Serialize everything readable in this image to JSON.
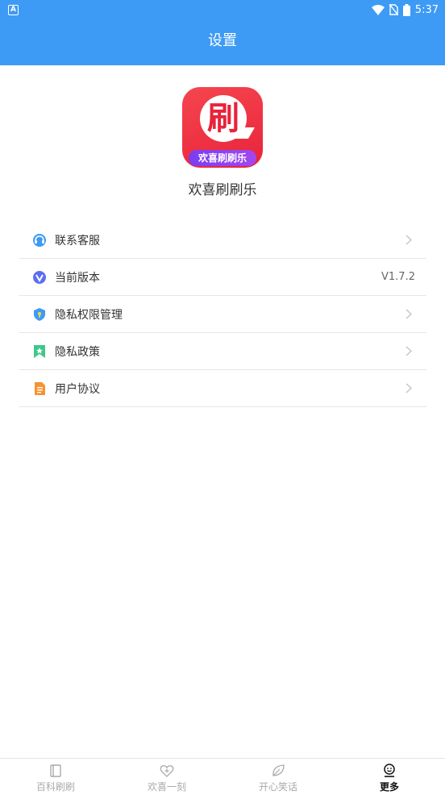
{
  "status_bar": {
    "time": "5:37",
    "app_indicator": "A"
  },
  "header": {
    "title": "设置"
  },
  "app": {
    "logo_char": "刷",
    "logo_banner": "欢喜刷刷乐",
    "name": "欢喜刷刷乐"
  },
  "menu": {
    "items": [
      {
        "label": "联系客服",
        "icon": "headset-icon",
        "color": "#3d9bf5"
      },
      {
        "label": "当前版本",
        "icon": "version-icon",
        "color": "#5b6ff0",
        "value": "V1.7.2"
      },
      {
        "label": "隐私权限管理",
        "icon": "shield-icon",
        "color": "#3d9bf5"
      },
      {
        "label": "隐私政策",
        "icon": "bookmark-icon",
        "color": "#3fc78a"
      },
      {
        "label": "用户协议",
        "icon": "document-icon",
        "color": "#f5932f"
      }
    ]
  },
  "tabbar": {
    "tabs": [
      {
        "label": "百科刷刷",
        "icon": "book-icon"
      },
      {
        "label": "欢喜一刻",
        "icon": "heart-plus-icon"
      },
      {
        "label": "开心笑话",
        "icon": "leaf-icon"
      },
      {
        "label": "更多",
        "icon": "smiley-icon",
        "active": true
      }
    ]
  },
  "colors": {
    "accent": "#3d9bf5",
    "divider": "#e6e6e6"
  }
}
